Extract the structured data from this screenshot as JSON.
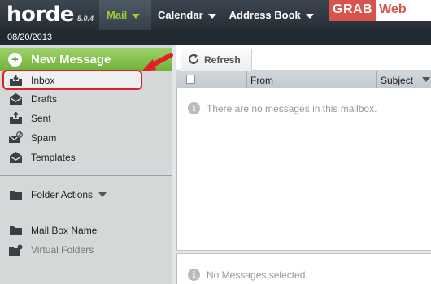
{
  "app": {
    "logo_text": "horde",
    "version": "5.0.4",
    "date": "08/20/2013"
  },
  "nav": {
    "mail": "Mail",
    "calendar": "Calendar",
    "address_book": "Address Book"
  },
  "watermark": {
    "part1": "GRAB",
    "part2": "Web"
  },
  "sidebar": {
    "new_message": "New Message",
    "folders": [
      {
        "label": "Inbox",
        "icon": "inbox-icon"
      },
      {
        "label": "Drafts",
        "icon": "drafts-icon"
      },
      {
        "label": "Sent",
        "icon": "sent-icon"
      },
      {
        "label": "Spam",
        "icon": "spam-icon"
      },
      {
        "label": "Templates",
        "icon": "templates-icon"
      }
    ],
    "folder_actions": "Folder Actions",
    "mailbox_name": "Mail Box Name",
    "virtual_folders": "Virtual Folders"
  },
  "toolbar": {
    "refresh": "Refresh"
  },
  "list": {
    "columns": {
      "from": "From",
      "subject": "Subject"
    },
    "empty_message": "There are no messages in this mailbox."
  },
  "preview": {
    "status": "No Messages selected."
  },
  "colors": {
    "accent_green": "#6fb33a",
    "highlight_red": "#d9232a",
    "topbar": "#262d35"
  }
}
